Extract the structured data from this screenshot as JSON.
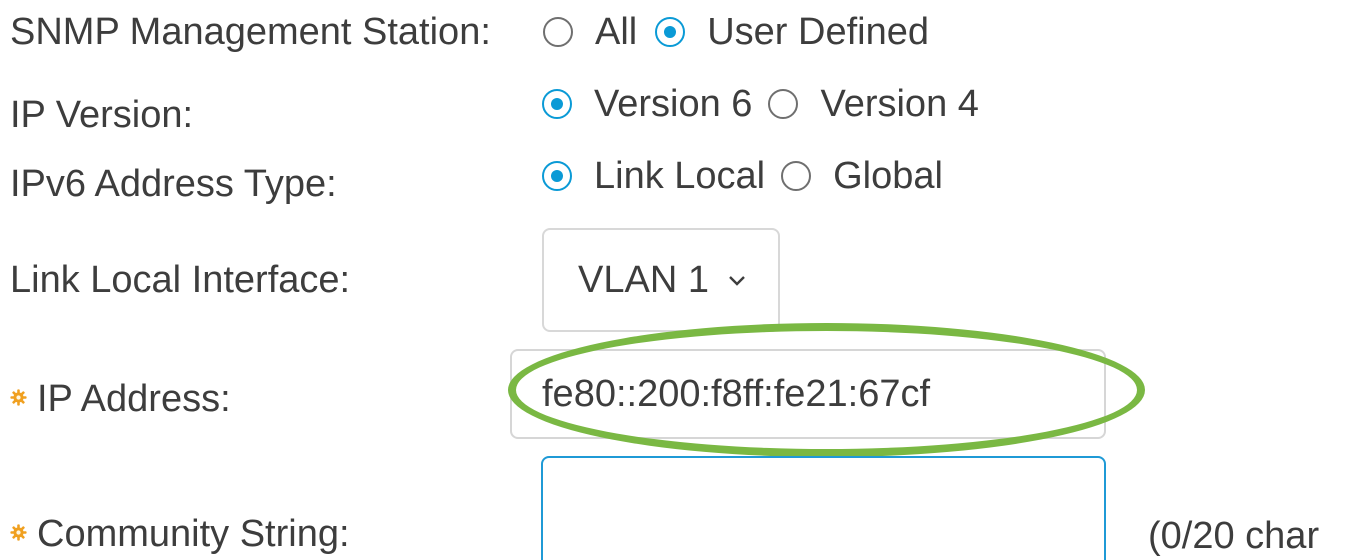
{
  "snmp_station": {
    "label": "SNMP Management Station:",
    "options": [
      "All",
      "User Defined"
    ],
    "selected": "User Defined"
  },
  "ip_version": {
    "label": "IP Version:",
    "options": [
      "Version 6",
      "Version 4"
    ],
    "selected": "Version 6"
  },
  "ipv6_address_type": {
    "label": "IPv6 Address Type:",
    "options": [
      "Link Local",
      "Global"
    ],
    "selected": "Link Local"
  },
  "link_local_interface": {
    "label": "Link Local Interface:",
    "value": "VLAN 1"
  },
  "ip_address": {
    "label": "IP Address:",
    "value": "fe80::200:f8ff:fe21:67cf"
  },
  "community_string": {
    "label": "Community String:",
    "value": "",
    "counter": "(0/20 char"
  },
  "colors": {
    "accent": "#0a9ad6",
    "highlight": "#7ab843",
    "required_icon": "#f0a020"
  },
  "icons": {
    "required": "gear-asterisk-icon",
    "dropdown": "chevron-down-icon"
  }
}
